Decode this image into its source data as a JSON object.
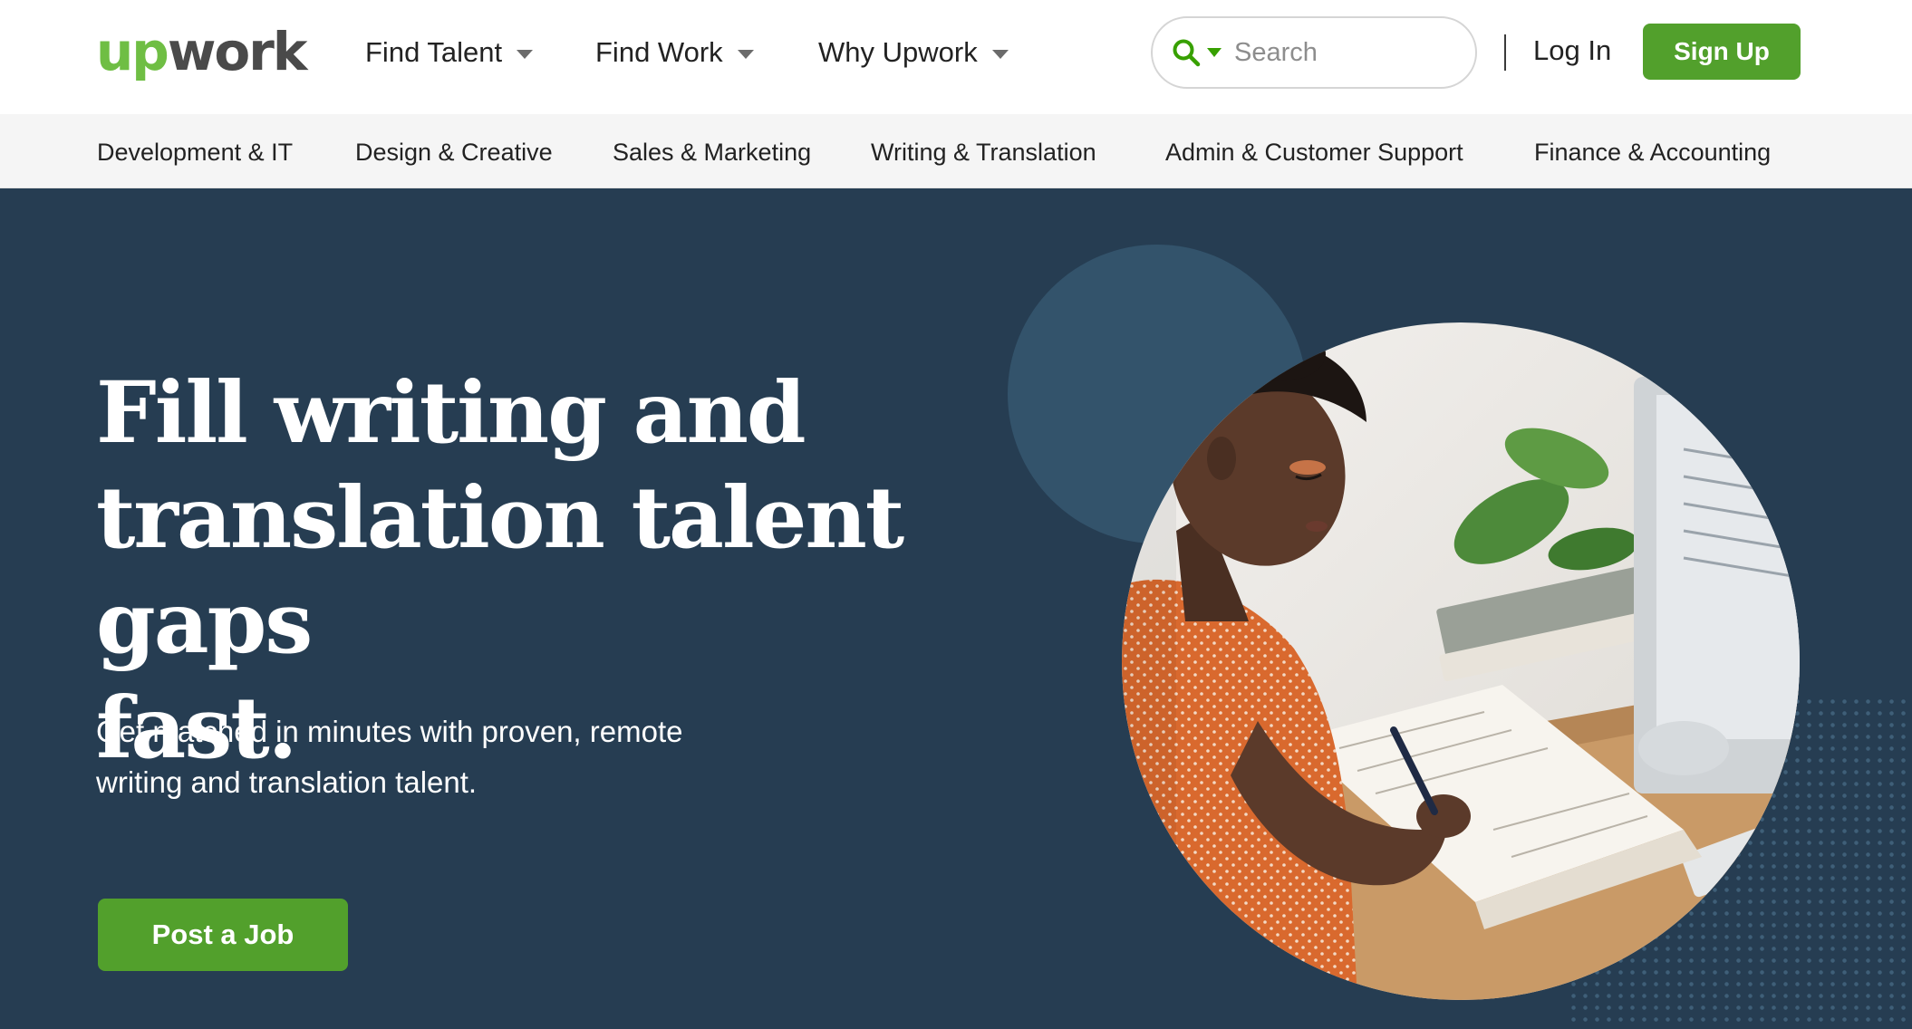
{
  "brand": {
    "logo_up": "up",
    "logo_work": "work",
    "accent_color": "#52a02c",
    "hero_bg_color": "#263d52"
  },
  "nav": {
    "items": [
      {
        "label": "Find Talent"
      },
      {
        "label": "Find Work"
      },
      {
        "label": "Why Upwork"
      }
    ],
    "search": {
      "placeholder": "Search",
      "value": ""
    },
    "login_label": "Log In",
    "signup_label": "Sign Up"
  },
  "categories": [
    {
      "label": "Development & IT"
    },
    {
      "label": "Design & Creative"
    },
    {
      "label": "Sales & Marketing"
    },
    {
      "label": "Writing & Translation"
    },
    {
      "label": "Admin & Customer Support"
    },
    {
      "label": "Finance & Accounting"
    }
  ],
  "hero": {
    "headline_line1": "Fill writing and",
    "headline_line2": "translation talent gaps",
    "headline_line3": "fast.",
    "subtext_line1": "Get matched in minutes with proven, remote",
    "subtext_line2": "writing and translation talent.",
    "cta_label": "Post a Job"
  },
  "icons": {
    "search": "search-icon",
    "caret": "chevron-down-icon"
  }
}
